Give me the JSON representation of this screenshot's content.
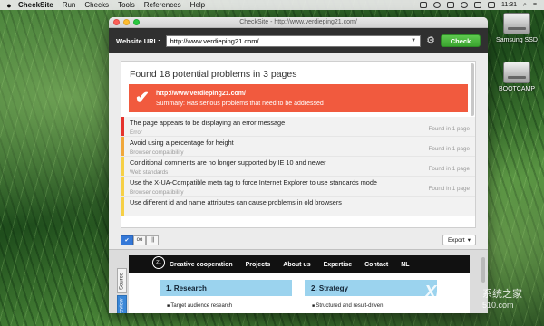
{
  "menubar": {
    "apple": "",
    "items": [
      "CheckSite",
      "Run",
      "Checks",
      "Tools",
      "References",
      "Help"
    ],
    "time": "11:31"
  },
  "desktop": {
    "icons": [
      {
        "label": "Samsung SSD"
      },
      {
        "label": "BOOTCAMP"
      }
    ]
  },
  "window": {
    "title": "CheckSite - http://www.verdieping21.com/",
    "toolbar": {
      "url_label": "Website URL:",
      "url_value": "http://www.verdieping21.com/",
      "check_label": "Check"
    },
    "results": {
      "heading": "Found 18 potential problems in 3 pages",
      "alert": {
        "url": "http://www.verdieping21.com/",
        "summary": "Summary: Has serious problems that need to be addressed"
      },
      "problems": [
        {
          "title": "The page appears to be displaying an error message",
          "category": "Error",
          "found": "Found in 1 page",
          "color": "#e5322d"
        },
        {
          "title": "Avoid using a percentage for height",
          "category": "Browser compatibility",
          "found": "Found in 1 page",
          "color": "#f0a73b"
        },
        {
          "title": "Conditional comments are no longer supported by IE 10 and newer",
          "category": "Web standards",
          "found": "Found in 1 page",
          "color": "#f6d046"
        },
        {
          "title": "Use the X-UA-Compatible meta tag to force Internet Explorer to use standards mode",
          "category": "Browser compatibility",
          "found": "Found in 1 page",
          "color": "#f6d046"
        },
        {
          "title": "Use different id and name attributes can cause problems in old browsers",
          "category": "",
          "found": "",
          "color": "#f6d046"
        }
      ]
    },
    "viewbar": {
      "export_label": "Export"
    },
    "preview": {
      "tabs": [
        "Source",
        "Preview"
      ],
      "site": {
        "logo": "21",
        "nav": [
          "Creative cooperation",
          "Projects",
          "About us",
          "Expertise",
          "Contact",
          "NL"
        ],
        "cards": [
          {
            "title": "1. Research",
            "item": "Target audience research"
          },
          {
            "title": "2. Strategy",
            "item": "Structured and result-driven"
          }
        ]
      }
    }
  },
  "watermark": {
    "brand": "XP",
    "cn": "系统之家",
    "domain": "510.com"
  },
  "colors": {
    "accent_blue": "#3478d8",
    "check_green": "#3aa52f",
    "alert_red": "#f15a3e"
  }
}
